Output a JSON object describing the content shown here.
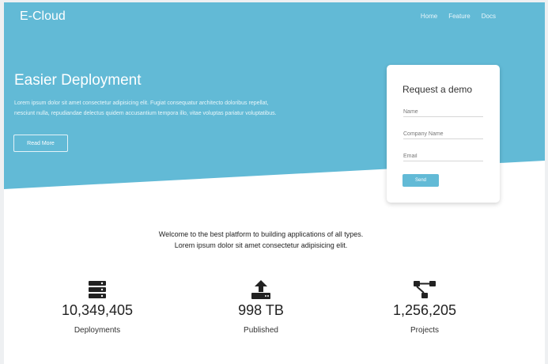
{
  "header": {
    "brand": "E-Cloud",
    "nav": [
      "Home",
      "Feature",
      "Docs"
    ]
  },
  "hero": {
    "title": "Easier Deployment",
    "text": "Lorem ipsum dolor sit amet consectetur adipisicing elit. Fugiat consequatur architecto doloribus repellat, nesciunt nulla, repudiandae delectus quidem accusantium tempora illo, vitae voluptas pariatur voluptatibus.",
    "button_label": "Read More",
    "background_color": "#62bad6"
  },
  "demo_form": {
    "title": "Request a demo",
    "fields": [
      {
        "placeholder": "Name"
      },
      {
        "placeholder": "Company Name"
      },
      {
        "placeholder": "Email"
      }
    ],
    "submit_label": "Send"
  },
  "intro": {
    "text": "Welcome to the best platform to building applications of all types. Lorem ipsum dolor sit amet consectetur adipisicing elit."
  },
  "stats": [
    {
      "icon": "server-icon",
      "value": "10,349,405",
      "label": "Deployments"
    },
    {
      "icon": "upload-icon",
      "value": "998 TB",
      "label": "Published"
    },
    {
      "icon": "project-diagram-icon",
      "value": "1,256,205",
      "label": "Projects"
    }
  ]
}
